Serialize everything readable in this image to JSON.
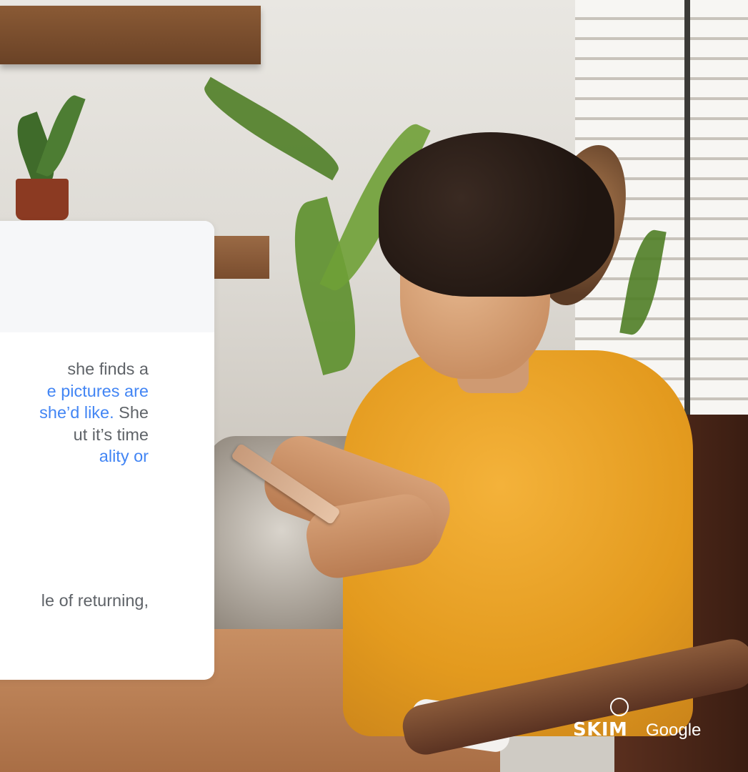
{
  "card": {
    "paragraph1": [
      {
        "text": "she finds a",
        "highlight": false
      },
      {
        "text": "e pictures are",
        "highlight": true
      },
      {
        "parts": [
          {
            "text": " she’d like.",
            "highlight": true
          },
          {
            "text": " She",
            "highlight": false
          }
        ]
      },
      {
        "text": "ut it’s time",
        "highlight": false
      },
      {
        "text": "ality or",
        "highlight": true
      }
    ],
    "paragraph2": [
      "le of returning,"
    ]
  },
  "logos": {
    "skim": "SKIM",
    "google": "Google"
  },
  "colors": {
    "highlight": "#4285f4",
    "body_text": "#5f6368",
    "card_header": "#f6f7f9"
  }
}
